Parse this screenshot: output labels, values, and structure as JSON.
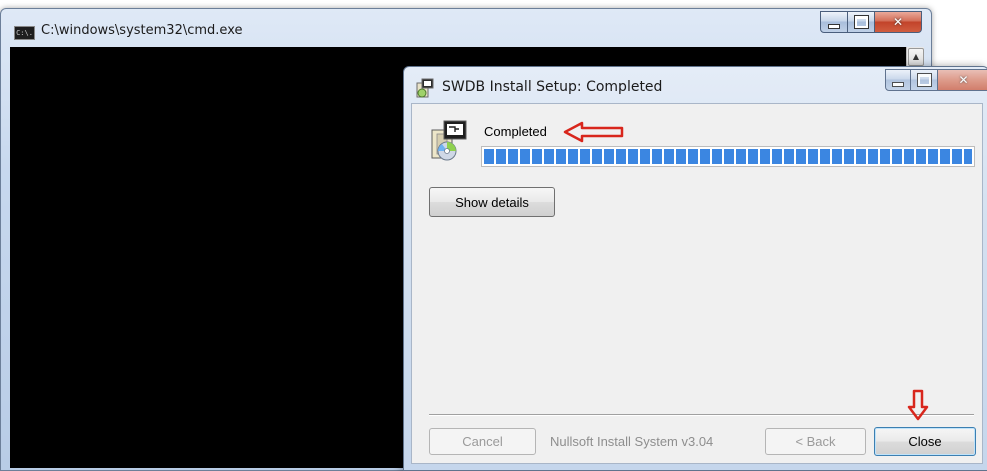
{
  "cmd_window": {
    "title": "C:\\windows\\system32\\cmd.exe",
    "icon_label": "C:\\."
  },
  "installer": {
    "title": "SWDB Install Setup: Completed",
    "status_text": "Completed",
    "progress_percent": 100,
    "show_details_label": "Show details",
    "cancel_label": "Cancel",
    "branding_text": "Nullsoft Install System v3.04",
    "back_label": "< Back",
    "close_label": "Close",
    "cancel_enabled": false,
    "back_enabled": false
  },
  "colors": {
    "progress_fill": "#3b86e1",
    "annotation_arrow": "#d8261c",
    "console_background": "#000000"
  },
  "icons": {
    "cmd": "cmd-app-icon",
    "installer": "installer-app-icon",
    "status": "install-package-icon",
    "annotations": [
      "red-arrow-left-icon",
      "red-arrow-down-icon"
    ]
  }
}
